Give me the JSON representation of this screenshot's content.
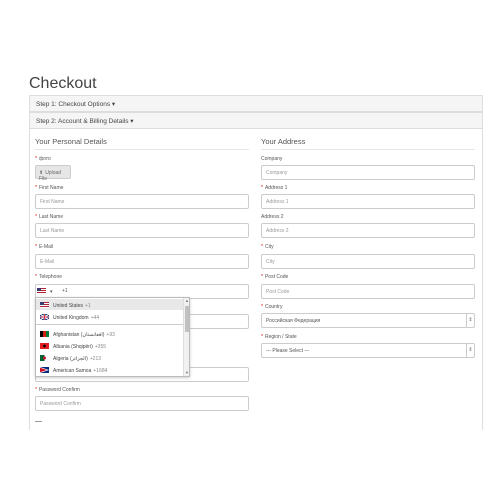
{
  "page": {
    "title": "Checkout"
  },
  "steps": {
    "step1": "Step 1: Checkout Options ▾",
    "step2": "Step 2: Account & Billing Details ▾"
  },
  "personal": {
    "legend": "Your Personal Details",
    "photo_label": "фото",
    "upload_label": "Upload File",
    "first_name_label": "First Name",
    "first_name_placeholder": "First Name",
    "last_name_label": "Last Name",
    "last_name_placeholder": "Last Name",
    "email_label": "E-Mail",
    "email_placeholder": "E-Mail",
    "telephone_label": "Telephone",
    "telephone_value": "+1",
    "password_confirm_label": "Password Confirm",
    "password_confirm_placeholder": "Password Confirm"
  },
  "phone_dropdown": {
    "items": [
      {
        "name": "United States",
        "dial": "+1",
        "flag": "us"
      },
      {
        "name": "United Kingdom",
        "dial": "+44",
        "flag": "uk"
      },
      {
        "name": "Afghanistan (‫افغانستان‬‎)",
        "dial": "+93",
        "flag": "af"
      },
      {
        "name": "Albania (Shqipëri)",
        "dial": "+355",
        "flag": "al"
      },
      {
        "name": "Algeria (‫الجزائر‬‎)",
        "dial": "+213",
        "flag": "dz"
      },
      {
        "name": "American Samoa",
        "dial": "+1684",
        "flag": "as"
      }
    ]
  },
  "address": {
    "legend": "Your Address",
    "company_label": "Company",
    "company_placeholder": "Company",
    "address1_label": "Address 1",
    "address1_placeholder": "Address 1",
    "address2_label": "Address 2",
    "address2_placeholder": "Address 2",
    "city_label": "City",
    "city_placeholder": "City",
    "postcode_label": "Post Code",
    "postcode_placeholder": "Post Code",
    "country_label": "Country",
    "country_value": "Российская Федерация",
    "region_label": "Region / State",
    "region_value": "--- Please Select ---"
  },
  "colors": {
    "required": "#dd0000",
    "panel_bg": "#f5f5f5",
    "border": "#cccccc"
  }
}
